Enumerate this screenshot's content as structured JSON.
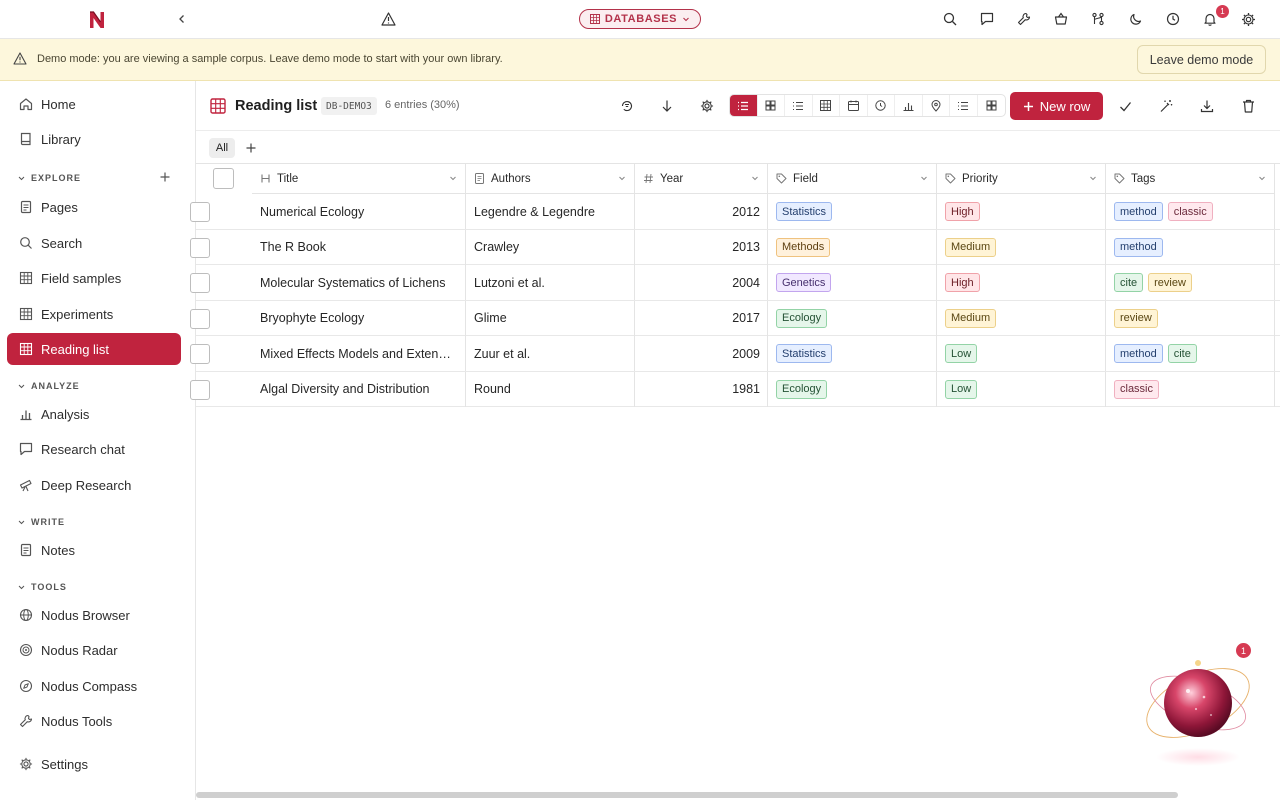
{
  "topbar": {
    "db_label": "DATABASES",
    "notif_count": "1"
  },
  "banner": {
    "text": "Demo mode: you are viewing a sample corpus. Leave demo mode to start with your own library.",
    "button": "Leave demo mode"
  },
  "sidebar": {
    "home": "Home",
    "library": "Library",
    "sections": {
      "explore": "EXPLORE",
      "analyze": "ANALYZE",
      "write": "WRITE",
      "tools": "TOOLS"
    },
    "explore_items": [
      "Pages",
      "Search",
      "Field samples",
      "Experiments",
      "Reading list"
    ],
    "analyze_items": [
      "Analysis",
      "Research chat",
      "Deep Research"
    ],
    "write_items": [
      "Notes"
    ],
    "tools_items": [
      "Nodus Browser",
      "Nodus Radar",
      "Nodus Compass",
      "Nodus Tools"
    ],
    "settings": "Settings",
    "active": "Reading list"
  },
  "header": {
    "title": "Reading list",
    "code": "DB-DEMO3",
    "count": "6 entries (30%)",
    "new_row": "New row"
  },
  "tabs": {
    "all": "All"
  },
  "table": {
    "columns": [
      "Title",
      "Authors",
      "Year",
      "Field",
      "Priority",
      "Tags"
    ],
    "rows": [
      {
        "title": "Numerical Ecology",
        "authors": "Legendre & Legendre",
        "year": "2012",
        "field": "Statistics",
        "priority": "High",
        "tags": [
          "method",
          "classic"
        ]
      },
      {
        "title": "The R Book",
        "authors": "Crawley",
        "year": "2013",
        "field": "Methods",
        "priority": "Medium",
        "tags": [
          "method"
        ]
      },
      {
        "title": "Molecular Systematics of Lichens",
        "authors": "Lutzoni et al.",
        "year": "2004",
        "field": "Genetics",
        "priority": "High",
        "tags": [
          "cite",
          "review"
        ]
      },
      {
        "title": "Bryophyte Ecology",
        "authors": "Glime",
        "year": "2017",
        "field": "Ecology",
        "priority": "Medium",
        "tags": [
          "review"
        ]
      },
      {
        "title": "Mixed Effects Models and Exten…",
        "authors": "Zuur et al.",
        "year": "2009",
        "field": "Statistics",
        "priority": "Low",
        "tags": [
          "method",
          "cite"
        ]
      },
      {
        "title": "Algal Diversity and Distribution",
        "authors": "Round",
        "year": "1981",
        "field": "Ecology",
        "priority": "Low",
        "tags": [
          "classic"
        ]
      }
    ]
  },
  "tag_colors": {
    "Statistics": "blue",
    "Methods": "orange",
    "Genetics": "purple",
    "Ecology": "green",
    "High": "red",
    "Medium": "yellow",
    "Low": "green",
    "method": "blue",
    "classic": "pink",
    "cite": "green",
    "review": "yellow"
  },
  "assistant": {
    "badge": "1"
  }
}
